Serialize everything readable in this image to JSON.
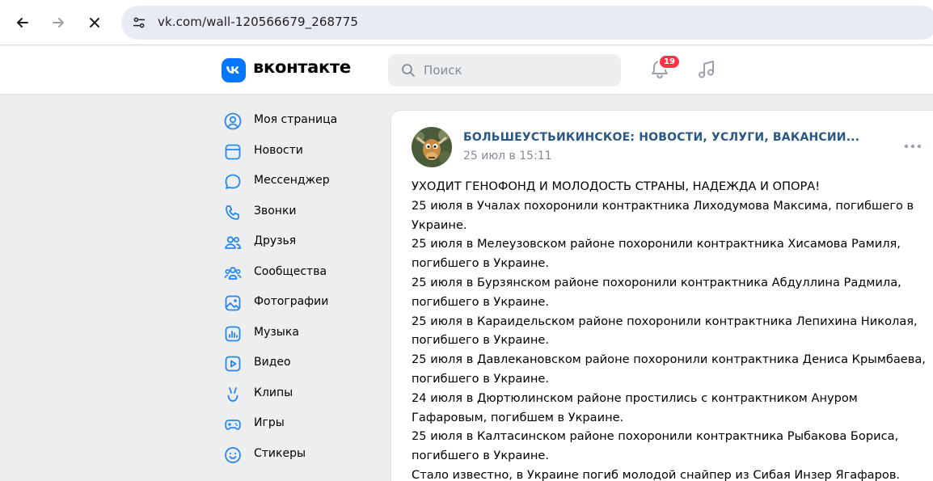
{
  "browser": {
    "url": "vk.com/wall-120566679_268775"
  },
  "header": {
    "wordmark": "вконтакте",
    "search_placeholder": "Поиск",
    "notifications_count": "19",
    "accent_color": "#0077ff",
    "badge_color": "#ff3347"
  },
  "sidebar": {
    "items": [
      {
        "label": "Моя страница",
        "icon": "user-circle-icon"
      },
      {
        "label": "Новости",
        "icon": "newsfeed-icon"
      },
      {
        "label": "Мессенджер",
        "icon": "message-icon"
      },
      {
        "label": "Звонки",
        "icon": "phone-icon"
      },
      {
        "label": "Друзья",
        "icon": "friends-icon"
      },
      {
        "label": "Сообщества",
        "icon": "communities-icon"
      },
      {
        "label": "Фотографии",
        "icon": "photo-icon"
      },
      {
        "label": "Музыка",
        "icon": "music-icon"
      },
      {
        "label": "Видео",
        "icon": "video-icon"
      },
      {
        "label": "Клипы",
        "icon": "clips-icon"
      },
      {
        "label": "Игры",
        "icon": "gamepad-icon"
      },
      {
        "label": "Стикеры",
        "icon": "smile-icon"
      }
    ]
  },
  "post": {
    "author": "БОЛЬШЕУСТЬИКИНСКОЕ: НОВОСТИ, УСЛУГИ, ВАКАНСИИ...",
    "date": "25 июл в 15:11",
    "lines": [
      "УХОДИТ ГЕНОФОНД И МОЛОДОСТЬ СТРАНЫ, НАДЕЖДА И ОПОРА!",
      "25 июля в Учалах похоронили контрактника Лиходумова Максима, погибшего в",
      "Украине.",
      "25 июля в Мелеузовском районе похоронили контрактника Хисамова Рамиля,",
      "погибшего в Украине.",
      "25 июля в Бурзянском районе похоронили контрактника Абдуллина Радмила,",
      "погибшего в Украине.",
      "25 июля в Караидельском районе похоронили контрактника Лепихина Николая,",
      "погибшего в Украине.",
      "25 июля в Давлекановском районе похоронили контрактника Дениса Крымбаева,",
      "погибшего в Украине.",
      "24 июля в Дюртюлинском районе простились с контрактником Ануром",
      "Гафаровым, погибшем в Украине.",
      "25 июля в Калтасинском районе похоронили контрактника Рыбакова Бориса,",
      "погибшего в Украине.",
      "Стало известно, в Украине погиб молодой снайпер из Сибая Инзер Ягафаров."
    ]
  }
}
